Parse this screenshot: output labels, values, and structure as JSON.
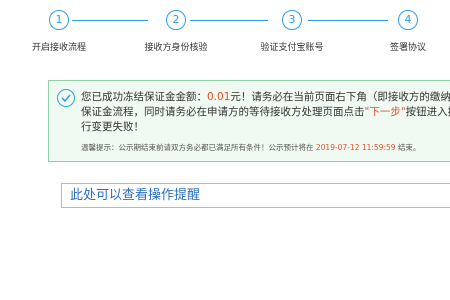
{
  "steps": [
    {
      "num": "1",
      "label": "开启接收流程"
    },
    {
      "num": "2",
      "label": "接收方身份核验"
    },
    {
      "num": "3",
      "label": "验证支付宝账号"
    },
    {
      "num": "4",
      "label": "签署协议"
    }
  ],
  "notice": {
    "prefix": "您已成功冻结保证金金额：",
    "amount": "0.01",
    "after_amount": "元！请务必在当前页面右下角（即接收方的缴纳保证金流程，同时请务必在申请方的等待接收方处理页面点击",
    "next_step": "\"下一步\"",
    "suffix": "按钮进入执行变更失败！",
    "tip_prefix": "温馨提示：公示期结束前请双方务必都已满足所有条件！公示预计将在",
    "tip_deadline": "2019-07-12 11:59:59",
    "tip_suffix": "结束。"
  },
  "reminder": {
    "text": "此处可以查看操作提醒"
  },
  "colors": {
    "accent": "#2f9ee8",
    "highlight": "#e0502e",
    "success_bg": "#f0faf2"
  },
  "icons": {
    "notice_icon": "check-circle-icon"
  }
}
